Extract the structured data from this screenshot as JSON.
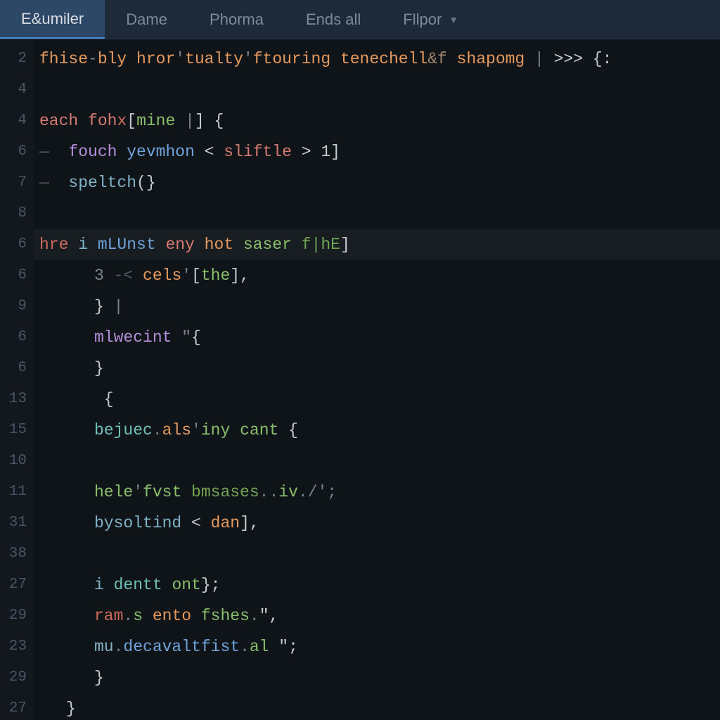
{
  "tabs": [
    {
      "label": "E&umiler",
      "active": true,
      "dropdown": false
    },
    {
      "label": "Dame",
      "active": false,
      "dropdown": false
    },
    {
      "label": "Phorma",
      "active": false,
      "dropdown": false
    },
    {
      "label": "Ends all",
      "active": false,
      "dropdown": false
    },
    {
      "label": "Fllpor",
      "active": false,
      "dropdown": true
    }
  ],
  "gutter": [
    "2",
    "4",
    "4",
    "6",
    "7",
    "8",
    "6",
    "6",
    "9",
    "6",
    "6",
    "13",
    "15",
    "10",
    "11",
    "31",
    "38",
    "27",
    "29",
    "23",
    "29",
    "27"
  ],
  "lines": [
    {
      "indent": 0,
      "hl": false,
      "tokens": [
        {
          "c": "t-or",
          "t": "fhise"
        },
        {
          "c": "t-gy",
          "t": "-"
        },
        {
          "c": "t-or",
          "t": "bly "
        },
        {
          "c": "t-or",
          "t": "hror"
        },
        {
          "c": "t-gy",
          "t": "'"
        },
        {
          "c": "t-or",
          "t": "tualty"
        },
        {
          "c": "t-gy",
          "t": "'"
        },
        {
          "c": "t-or",
          "t": "ftouring "
        },
        {
          "c": "t-or",
          "t": "tenechell"
        },
        {
          "c": "t-br",
          "t": "&f "
        },
        {
          "c": "t-or",
          "t": "shapomg "
        },
        {
          "c": "t-gy",
          "t": "| "
        },
        {
          "c": "t-wt",
          "t": ">>> "
        },
        {
          "c": "t-wt",
          "t": "{:"
        }
      ]
    },
    {
      "indent": 0,
      "hl": false,
      "tokens": []
    },
    {
      "indent": 0,
      "hl": false,
      "tokens": [
        {
          "c": "t-rd",
          "t": "each "
        },
        {
          "c": "t-rd",
          "t": "foh"
        },
        {
          "c": "t-rd2",
          "t": "x"
        },
        {
          "c": "t-wt",
          "t": "["
        },
        {
          "c": "t-gr",
          "t": "mine"
        },
        {
          "c": "t-gy",
          "t": " |"
        },
        {
          "c": "t-wt",
          "t": "]"
        },
        {
          "c": "t-wt",
          "t": " {"
        }
      ]
    },
    {
      "indent": 0,
      "hl": false,
      "tokens": [
        {
          "c": "t-dm",
          "t": "—  "
        },
        {
          "c": "t-pu",
          "t": "fouch "
        },
        {
          "c": "t-bl",
          "t": "yevmhon "
        },
        {
          "c": "t-wt",
          "t": "< "
        },
        {
          "c": "t-rd",
          "t": "sliftle "
        },
        {
          "c": "t-wt",
          "t": "> "
        },
        {
          "c": "t-wt",
          "t": "1]"
        }
      ]
    },
    {
      "indent": 0,
      "hl": false,
      "tokens": [
        {
          "c": "t-dm",
          "t": "—  "
        },
        {
          "c": "t-cy",
          "t": "speltch"
        },
        {
          "c": "t-wt",
          "t": "(}"
        }
      ]
    },
    {
      "indent": 0,
      "hl": false,
      "tokens": []
    },
    {
      "indent": 2,
      "hl": true,
      "tokens": [
        {
          "c": "t-rd2",
          "t": "hre "
        },
        {
          "c": "t-cy",
          "t": "i "
        },
        {
          "c": "t-bl",
          "t": "mLUnst "
        },
        {
          "c": "t-rd",
          "t": "eny "
        },
        {
          "c": "t-or",
          "t": "hot "
        },
        {
          "c": "t-gr",
          "t": "saser "
        },
        {
          "c": "t-grd",
          "t": "f|hE"
        },
        {
          "c": "t-wt",
          "t": "]"
        }
      ]
    },
    {
      "indent": 2,
      "hl": false,
      "tokens": [
        {
          "c": "t-gy",
          "t": "3 "
        },
        {
          "c": "t-dm",
          "t": "-< "
        },
        {
          "c": "t-or",
          "t": "cels"
        },
        {
          "c": "t-gy",
          "t": "'"
        },
        {
          "c": "t-wt",
          "t": "["
        },
        {
          "c": "t-gr",
          "t": "the"
        },
        {
          "c": "t-wt",
          "t": "],"
        }
      ]
    },
    {
      "indent": 2,
      "hl": false,
      "tokens": [
        {
          "c": "t-wt",
          "t": "} "
        },
        {
          "c": "t-gy",
          "t": "|"
        }
      ]
    },
    {
      "indent": 2,
      "hl": false,
      "tokens": [
        {
          "c": "t-pu",
          "t": "mlwecint "
        },
        {
          "c": "t-gy",
          "t": "\""
        },
        {
          "c": "t-wt",
          "t": "{"
        }
      ]
    },
    {
      "indent": 2,
      "hl": false,
      "tokens": [
        {
          "c": "t-wt",
          "t": "}"
        }
      ]
    },
    {
      "indent": 2,
      "hl": false,
      "tokens": [
        {
          "c": "t-wt",
          "t": " {"
        }
      ]
    },
    {
      "indent": 2,
      "hl": false,
      "tokens": [
        {
          "c": "t-aq",
          "t": "bejuec"
        },
        {
          "c": "t-gy",
          "t": "."
        },
        {
          "c": "t-or",
          "t": "als"
        },
        {
          "c": "t-gy",
          "t": "'"
        },
        {
          "c": "t-gr",
          "t": "iny "
        },
        {
          "c": "t-gr",
          "t": "cant "
        },
        {
          "c": "t-wt",
          "t": "{"
        }
      ]
    },
    {
      "indent": 2,
      "hl": false,
      "tokens": []
    },
    {
      "indent": 2,
      "hl": false,
      "tokens": [
        {
          "c": "t-gr",
          "t": "hele"
        },
        {
          "c": "t-gy",
          "t": "'"
        },
        {
          "c": "t-gr",
          "t": "fvst "
        },
        {
          "c": "t-grd",
          "t": "bmsases"
        },
        {
          "c": "t-gy",
          "t": ".."
        },
        {
          "c": "t-gr",
          "t": "iv"
        },
        {
          "c": "t-gy",
          "t": "."
        },
        {
          "c": "t-gy",
          "t": "/';"
        }
      ]
    },
    {
      "indent": 2,
      "hl": false,
      "tokens": [
        {
          "c": "t-cy",
          "t": "bysoltind "
        },
        {
          "c": "t-wt",
          "t": "< "
        },
        {
          "c": "t-or",
          "t": "dan"
        },
        {
          "c": "t-wt",
          "t": "],"
        }
      ]
    },
    {
      "indent": 2,
      "hl": false,
      "tokens": []
    },
    {
      "indent": 2,
      "hl": false,
      "tokens": [
        {
          "c": "t-cy",
          "t": "i "
        },
        {
          "c": "t-aq",
          "t": "dentt "
        },
        {
          "c": "t-gr",
          "t": "ont"
        },
        {
          "c": "t-wt",
          "t": "};"
        }
      ]
    },
    {
      "indent": 2,
      "hl": false,
      "tokens": [
        {
          "c": "t-rd2",
          "t": "ram"
        },
        {
          "c": "t-gy",
          "t": "."
        },
        {
          "c": "t-gr",
          "t": "s "
        },
        {
          "c": "t-or",
          "t": "ento "
        },
        {
          "c": "t-gr",
          "t": "fshes"
        },
        {
          "c": "t-gy",
          "t": "."
        },
        {
          "c": "t-wt",
          "t": "\","
        }
      ]
    },
    {
      "indent": 2,
      "hl": false,
      "tokens": [
        {
          "c": "t-cy",
          "t": "mu"
        },
        {
          "c": "t-gy",
          "t": "."
        },
        {
          "c": "t-bl",
          "t": "decavaltfist"
        },
        {
          "c": "t-gy",
          "t": "."
        },
        {
          "c": "t-gr",
          "t": "al "
        },
        {
          "c": "t-wt",
          "t": "\";"
        }
      ]
    },
    {
      "indent": 2,
      "hl": false,
      "tokens": [
        {
          "c": "t-wt",
          "t": "}"
        }
      ]
    },
    {
      "indent": 1,
      "hl": false,
      "tokens": [
        {
          "c": "t-wt",
          "t": "}"
        }
      ]
    }
  ]
}
